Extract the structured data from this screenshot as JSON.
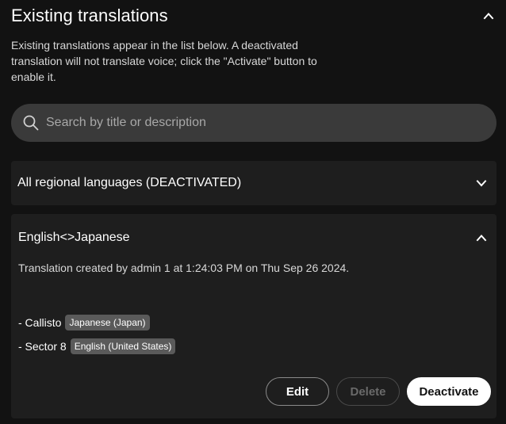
{
  "section": {
    "title": "Existing translations",
    "description": "Existing translations appear in the list below. A deactivated translation will not translate voice; click the \"Activate\" button to enable it."
  },
  "search": {
    "placeholder": "Search by title or description",
    "value": ""
  },
  "translations": [
    {
      "title": "All regional languages (DEACTIVATED)",
      "expanded": false
    },
    {
      "title": "English<>Japanese",
      "expanded": true,
      "created": "Translation created by admin 1 at 1:24:03 PM on Thu Sep 26 2024.",
      "members": [
        {
          "name": "- Callisto",
          "language": "Japanese (Japan)"
        },
        {
          "name": "- Sector 8",
          "language": "English (United States)"
        }
      ],
      "actions": {
        "edit": "Edit",
        "delete": "Delete",
        "deactivate": "Deactivate"
      }
    }
  ],
  "icons": {
    "collapse": "chevron-up-icon",
    "expand": "chevron-down-icon",
    "search": "search-icon"
  },
  "colors": {
    "background": "#121212",
    "card": "#1e1e1e",
    "search_field": "#3a3a3a",
    "tag": "#5a5a5a",
    "primary_button": "#ffffff"
  }
}
